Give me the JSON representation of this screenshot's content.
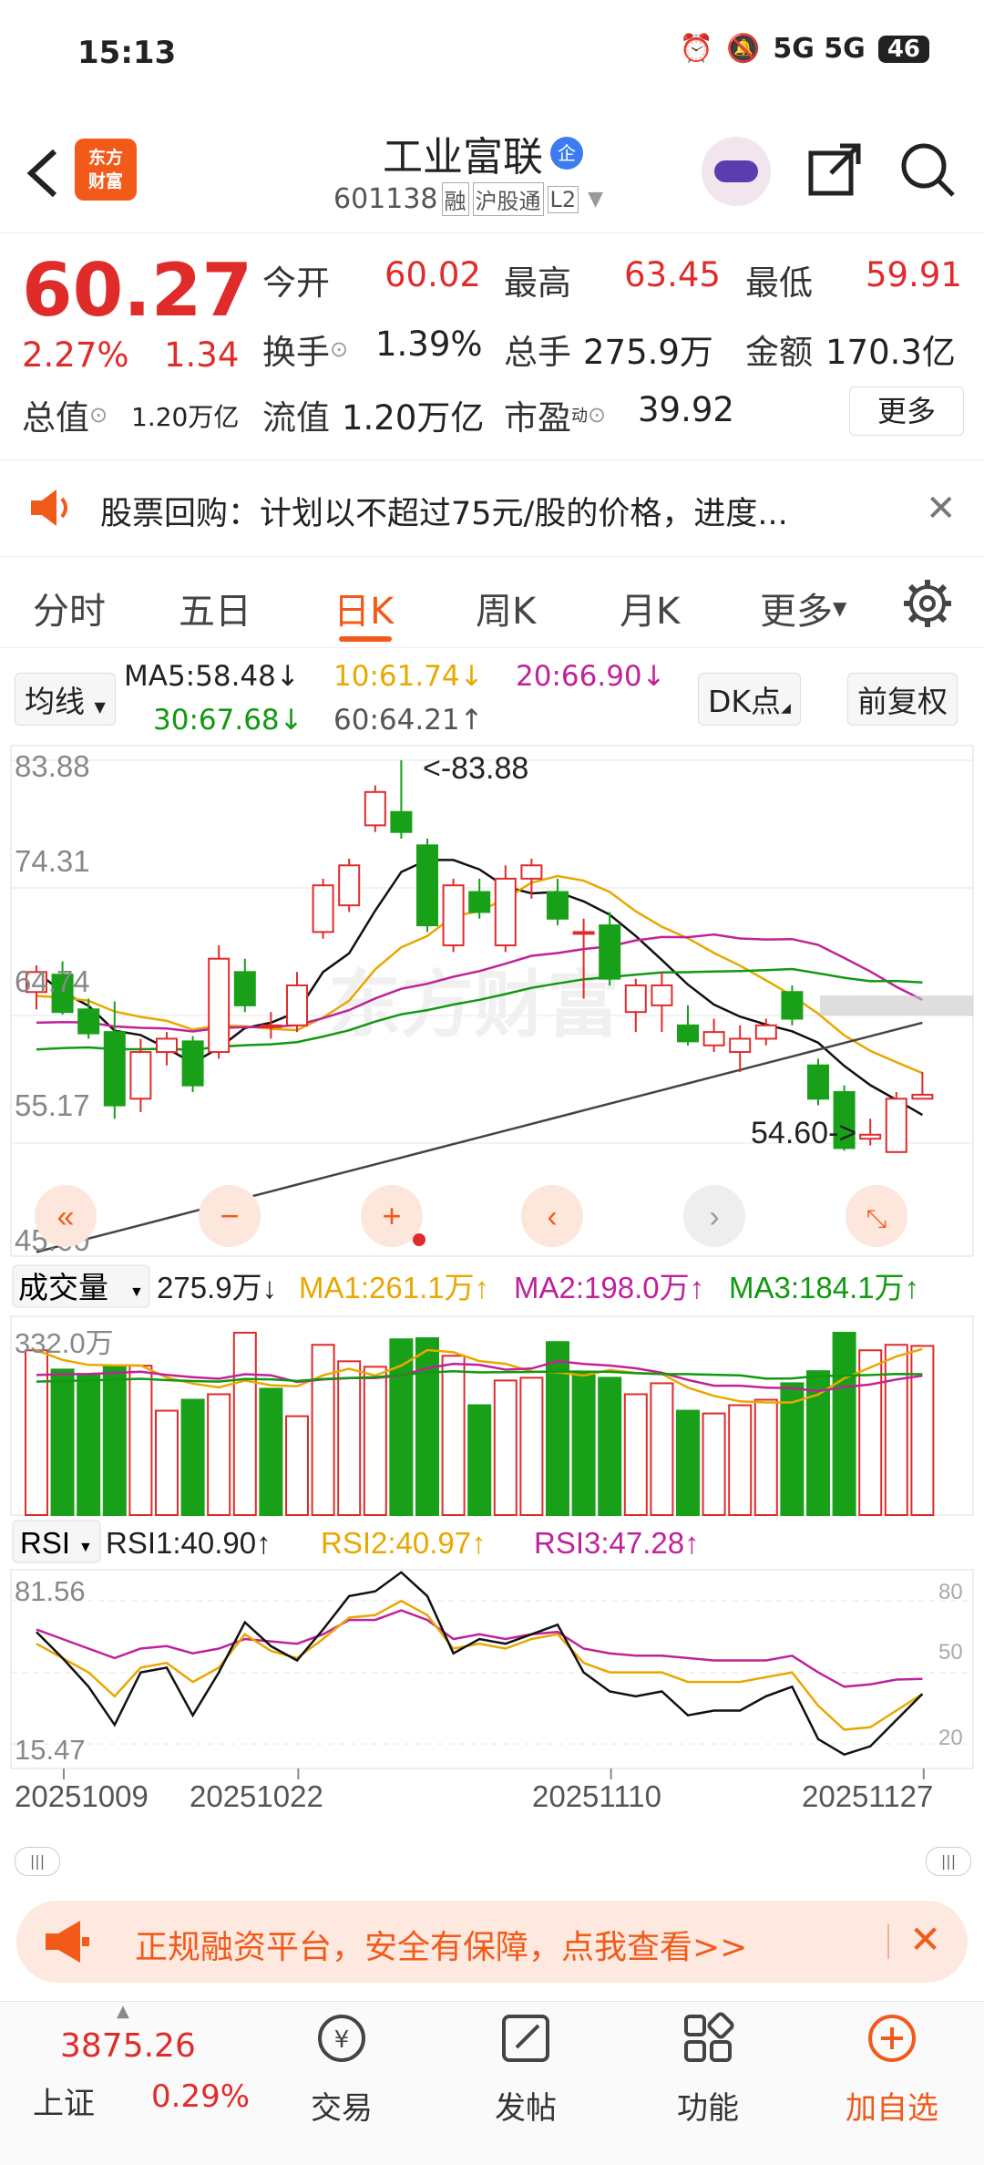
{
  "status_bar": {
    "time": "15:13",
    "network": "5G 5G",
    "battery": "46"
  },
  "header": {
    "stock_name": "工业富联",
    "stock_badge": "企",
    "code": "601138",
    "tag_rong": "融",
    "tag_hgt": "沪股通",
    "tag_l2": "L2",
    "logo_text_line1": "东方",
    "logo_text_line2": "财富"
  },
  "quote": {
    "price": "60.27",
    "change_pct": "2.27%",
    "change_amt": "1.34",
    "open_label": "今开",
    "open_value": "60.02",
    "high_label": "最高",
    "high_value": "63.45",
    "low_label": "最低",
    "low_value": "59.91",
    "turnover_label": "换手",
    "turnover_value": "1.39%",
    "volume_label": "总手",
    "volume_value": "275.9万",
    "amount_label": "金额",
    "amount_value": "170.3亿",
    "mktcap_label": "总值",
    "mktcap_value": "1.20万亿",
    "float_label": "流值",
    "float_value": "1.20万亿",
    "pe_label": "市盈",
    "pe_sup": "动",
    "pe_value": "39.92",
    "more_label": "更多"
  },
  "notice": {
    "text": "股票回购：计划以不超过75元/股的价格，进度..."
  },
  "tabs": [
    "分时",
    "五日",
    "日K",
    "周K",
    "月K",
    "更多"
  ],
  "active_tab": "日K",
  "ma_row": {
    "dropdown": "均线",
    "ma5": "MA5:58.48↓",
    "ma10": "10:61.74↓",
    "ma20": "20:66.90↓",
    "ma30": "30:67.68↓",
    "ma60": "60:64.21↑",
    "dk_label": "DK点",
    "adjust_label": "前复权"
  },
  "kline": {
    "y_labels": [
      "83.88",
      "74.31",
      "64.74",
      "55.17",
      "45.60"
    ],
    "high_marker": "<-83.88",
    "low_marker": "54.60->",
    "watermark": "东方财富"
  },
  "volume": {
    "dropdown": "成交量",
    "value": "275.9万↓",
    "ma1": "MA1:261.1万↑",
    "ma2": "MA2:198.0万↑",
    "ma3": "MA3:184.1万↑",
    "max_label": "332.0万"
  },
  "rsi": {
    "dropdown": "RSI",
    "rsi1": "RSI1:40.90↑",
    "rsi2": "RSI2:40.97↑",
    "rsi3": "RSI3:47.28↑",
    "y_top": "81.56",
    "y_bottom": "15.47",
    "r80": "80",
    "r50": "50",
    "r20": "20"
  },
  "dates": [
    "20251009",
    "20251022",
    "20251110",
    "20251127"
  ],
  "ad": {
    "text": "正规融资平台，安全有保障，点我查看>>"
  },
  "bottom_nav": {
    "index_value": "3875.26",
    "index_name": "上证",
    "index_pct": "0.29%",
    "trade": "交易",
    "post": "发帖",
    "function": "功能",
    "add_watch": "加自选"
  },
  "colors": {
    "up": "#e02b2b",
    "down": "#18a018",
    "accent": "#f25a1a"
  },
  "candles": [
    [
      0,
      [
        66.5,
        68.5,
        65.2,
        68.0
      ]
    ],
    [
      1,
      [
        67.8,
        68.8,
        64.8,
        65.0
      ]
    ],
    [
      2,
      [
        65.2,
        66.0,
        63.0,
        63.4
      ]
    ],
    [
      3,
      [
        63.5,
        65.8,
        57.0,
        58.0
      ]
    ],
    [
      4,
      [
        58.5,
        63.0,
        57.5,
        62.0
      ]
    ],
    [
      5,
      [
        62.0,
        63.5,
        61.0,
        63.0
      ]
    ],
    [
      6,
      [
        62.8,
        63.2,
        59.0,
        59.5
      ]
    ],
    [
      7,
      [
        62.0,
        70.0,
        61.5,
        69.0
      ]
    ],
    [
      8,
      [
        68.0,
        69.0,
        65.0,
        65.5
      ]
    ],
    [
      9,
      [
        64.0,
        65.0,
        63.0,
        64.0
      ]
    ],
    [
      10,
      [
        64.0,
        68.0,
        63.5,
        67.0
      ]
    ],
    [
      11,
      [
        71.0,
        75.0,
        70.5,
        74.5
      ]
    ],
    [
      12,
      [
        73.0,
        76.5,
        72.5,
        76.0
      ]
    ],
    [
      13,
      [
        79.0,
        82.0,
        78.5,
        81.5
      ]
    ],
    [
      14,
      [
        80.0,
        83.88,
        78.0,
        78.5
      ]
    ],
    [
      15,
      [
        77.5,
        78.0,
        71.0,
        71.5
      ]
    ],
    [
      16,
      [
        70.0,
        75.0,
        69.5,
        74.5
      ]
    ],
    [
      17,
      [
        74.0,
        75.0,
        72.0,
        72.5
      ]
    ],
    [
      18,
      [
        70.0,
        76.0,
        69.5,
        75.0
      ]
    ],
    [
      19,
      [
        75.0,
        76.5,
        73.5,
        76.0
      ]
    ],
    [
      20,
      [
        74.0,
        75.0,
        71.5,
        72.0
      ]
    ],
    [
      21,
      [
        71.0,
        72.0,
        66.0,
        71.0
      ]
    ],
    [
      22,
      [
        71.5,
        72.5,
        67.0,
        67.5
      ]
    ],
    [
      23,
      [
        65.0,
        67.5,
        63.5,
        67.0
      ]
    ],
    [
      24,
      [
        65.5,
        68.0,
        63.5,
        67.0
      ]
    ],
    [
      25,
      [
        64.0,
        65.5,
        62.5,
        62.8
      ]
    ],
    [
      26,
      [
        62.5,
        64.5,
        62.0,
        63.5
      ]
    ],
    [
      27,
      [
        62.0,
        64.0,
        60.5,
        63.0
      ]
    ],
    [
      28,
      [
        63.0,
        64.5,
        62.5,
        64.0
      ]
    ],
    [
      29,
      [
        66.5,
        67.0,
        64.0,
        64.5
      ]
    ],
    [
      30,
      [
        61.0,
        61.5,
        58.0,
        58.5
      ]
    ],
    [
      31,
      [
        59.0,
        59.5,
        54.6,
        54.8
      ]
    ],
    [
      32,
      [
        55.5,
        57.0,
        55.0,
        55.8
      ]
    ],
    [
      33,
      [
        54.5,
        59.0,
        54.5,
        58.5
      ]
    ],
    [
      34,
      [
        58.5,
        60.5,
        58.5,
        58.8
      ]
    ]
  ],
  "volumes": [
    300,
    265,
    255,
    270,
    272,
    190,
    210,
    220,
    332,
    230,
    180,
    310,
    280,
    270,
    320,
    322,
    290,
    200,
    245,
    250,
    315,
    260,
    250,
    220,
    240,
    190,
    185,
    200,
    210,
    240,
    262,
    332,
    300,
    310,
    308
  ],
  "vol_up": [
    1,
    0,
    0,
    0,
    1,
    1,
    0,
    1,
    1,
    0,
    1,
    1,
    1,
    1,
    0,
    0,
    1,
    0,
    1,
    1,
    0,
    0,
    0,
    1,
    1,
    0,
    1,
    1,
    1,
    0,
    0,
    0,
    1,
    1,
    1
  ],
  "rsi_series": {
    "rsi1": [
      67,
      56,
      44,
      28,
      50,
      52,
      32,
      50,
      71,
      61,
      55,
      68,
      82,
      84,
      92,
      82,
      58,
      64,
      62,
      66,
      70,
      50,
      42,
      40,
      42,
      32,
      34,
      34,
      40,
      44,
      22,
      15.5,
      19,
      30,
      41
    ],
    "rsi2": [
      62,
      56,
      50,
      40,
      52,
      54,
      46,
      52,
      66,
      59,
      56,
      64,
      73,
      74,
      80,
      74,
      60,
      62,
      60,
      64,
      66,
      54,
      50,
      50,
      50,
      46,
      46,
      46,
      48,
      50,
      36,
      26,
      27,
      34,
      41
    ],
    "rsi3": [
      68,
      64,
      60,
      56,
      60,
      61,
      58,
      60,
      64,
      63,
      62,
      66,
      72,
      72,
      76,
      72,
      64,
      66,
      64,
      66,
      67,
      60,
      58,
      57,
      57,
      56,
      55,
      55,
      55,
      57,
      50,
      44,
      45,
      47,
      47.3
    ]
  }
}
